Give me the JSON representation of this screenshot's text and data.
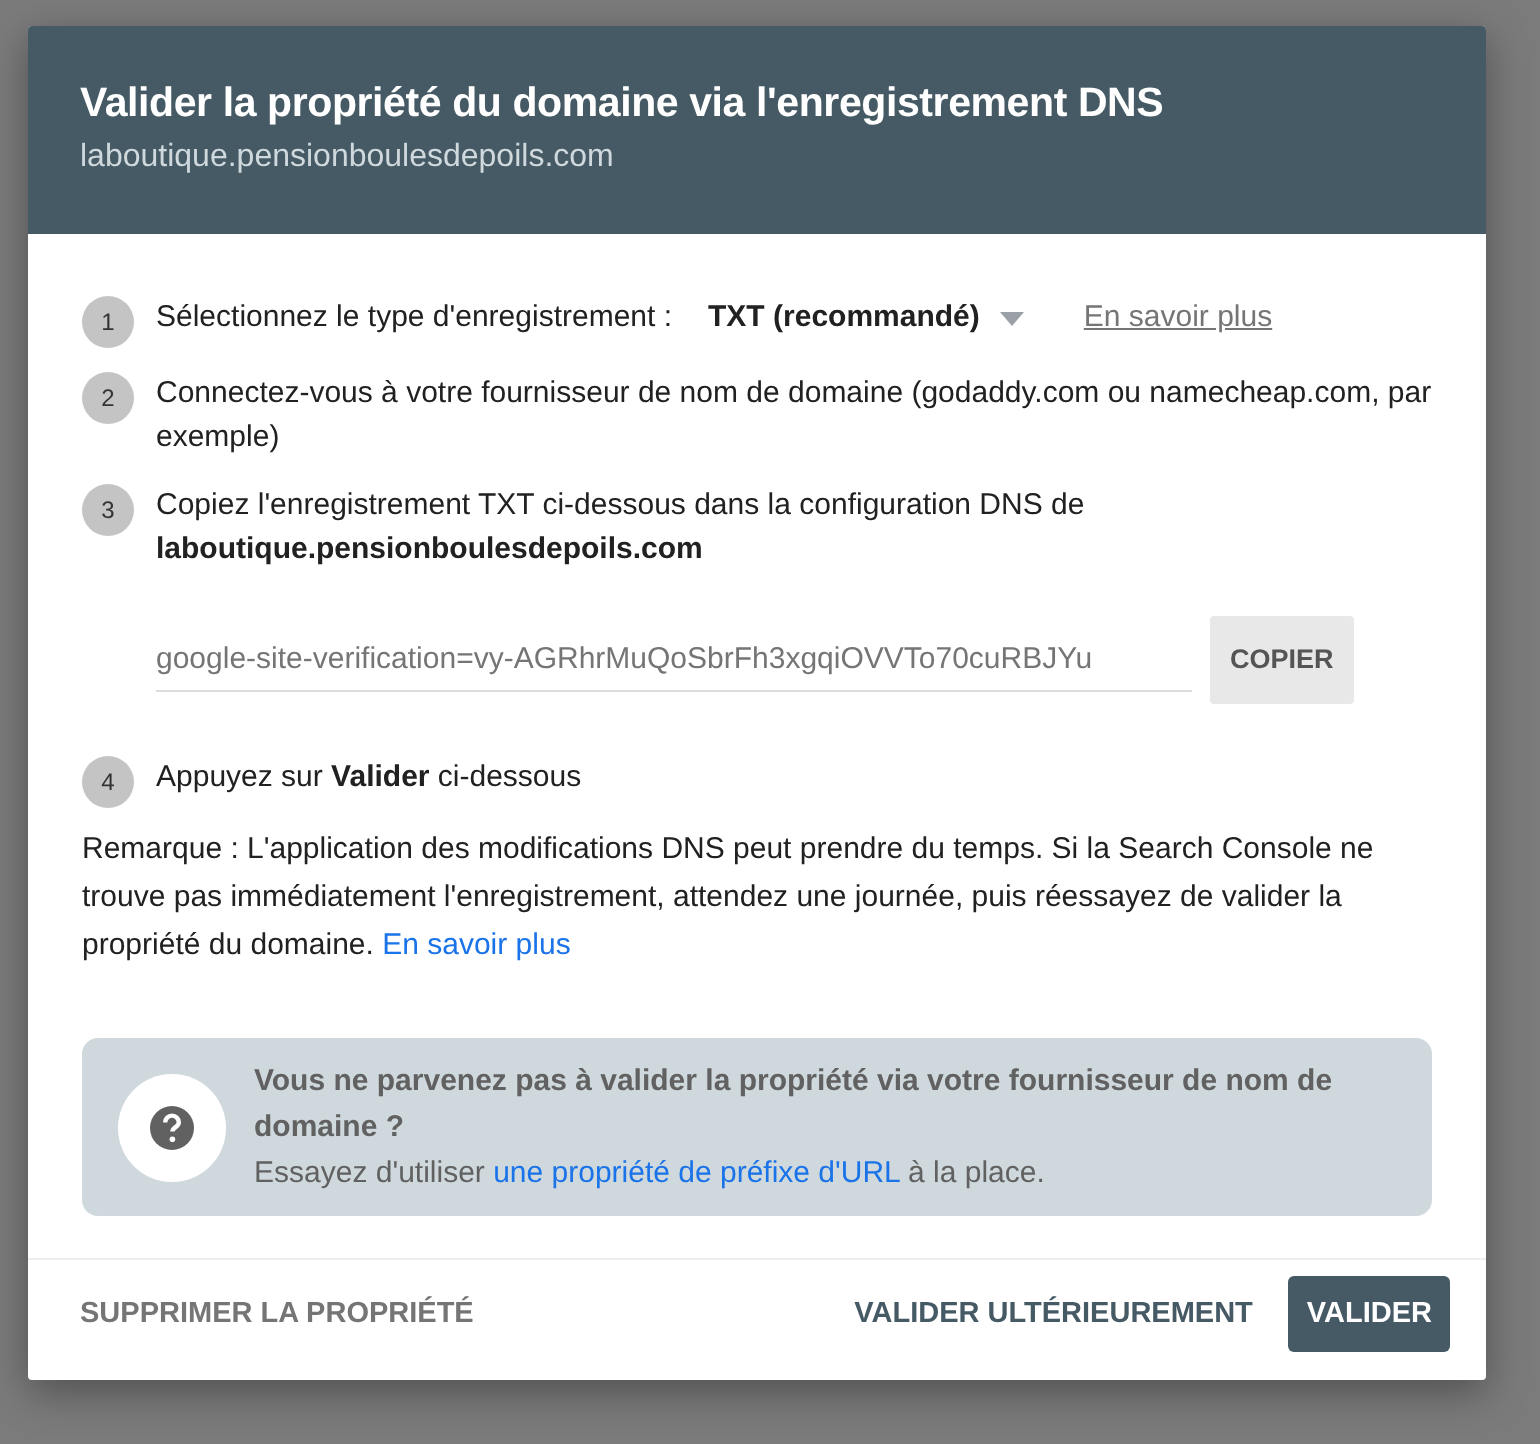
{
  "dialog": {
    "title": "Valider la propriété du domaine via l'enregistrement DNS",
    "subtitle": "laboutique.pensionboulesdepoils.com"
  },
  "steps": [
    {
      "kind": "select",
      "number": "1",
      "text": "Sélectionnez le type d'enregistrement :",
      "select_value": "TXT (recommandé)",
      "link": "En savoir plus"
    },
    {
      "kind": "plain",
      "number": "2",
      "text": "Connectez-vous à votre fournisseur de nom de domaine (godaddy.com ou namecheap.com, par exemple)"
    },
    {
      "kind": "copy",
      "number": "3",
      "text": "Copiez l'enregistrement TXT ci-dessous dans la configuration DNS de **laboutique.pensionboulesdepoils.com**",
      "field_value": "google-site-verification=vy-AGRhrMuQoSbrFh3xgqiOVVTo70cuRBJYu",
      "button": "COPIER"
    },
    {
      "kind": "plain",
      "number": "4",
      "text": "Appuyez sur **Valider** ci-dessous"
    }
  ],
  "note": {
    "text": "Remarque : L'application des modifications DNS peut prendre du temps. Si la Search Console ne trouve pas immédiatement l'enregistrement, attendez une journée, puis réessayez de valider la propriété du domaine.",
    "link": "En savoir plus"
  },
  "help": {
    "title": "Vous ne parvenez pas à valider la propriété via votre fournisseur de nom de domaine ?",
    "text_before": "Essayez d'utiliser",
    "link": "une propriété de préfixe d'URL",
    "text_after": "à la place."
  },
  "footer": {
    "left_button": "SUPPRIMER LA PROPRIÉTÉ",
    "secondary_button": "VALIDER ULTÉRIEUREMENT",
    "primary_button": "VALIDER"
  }
}
